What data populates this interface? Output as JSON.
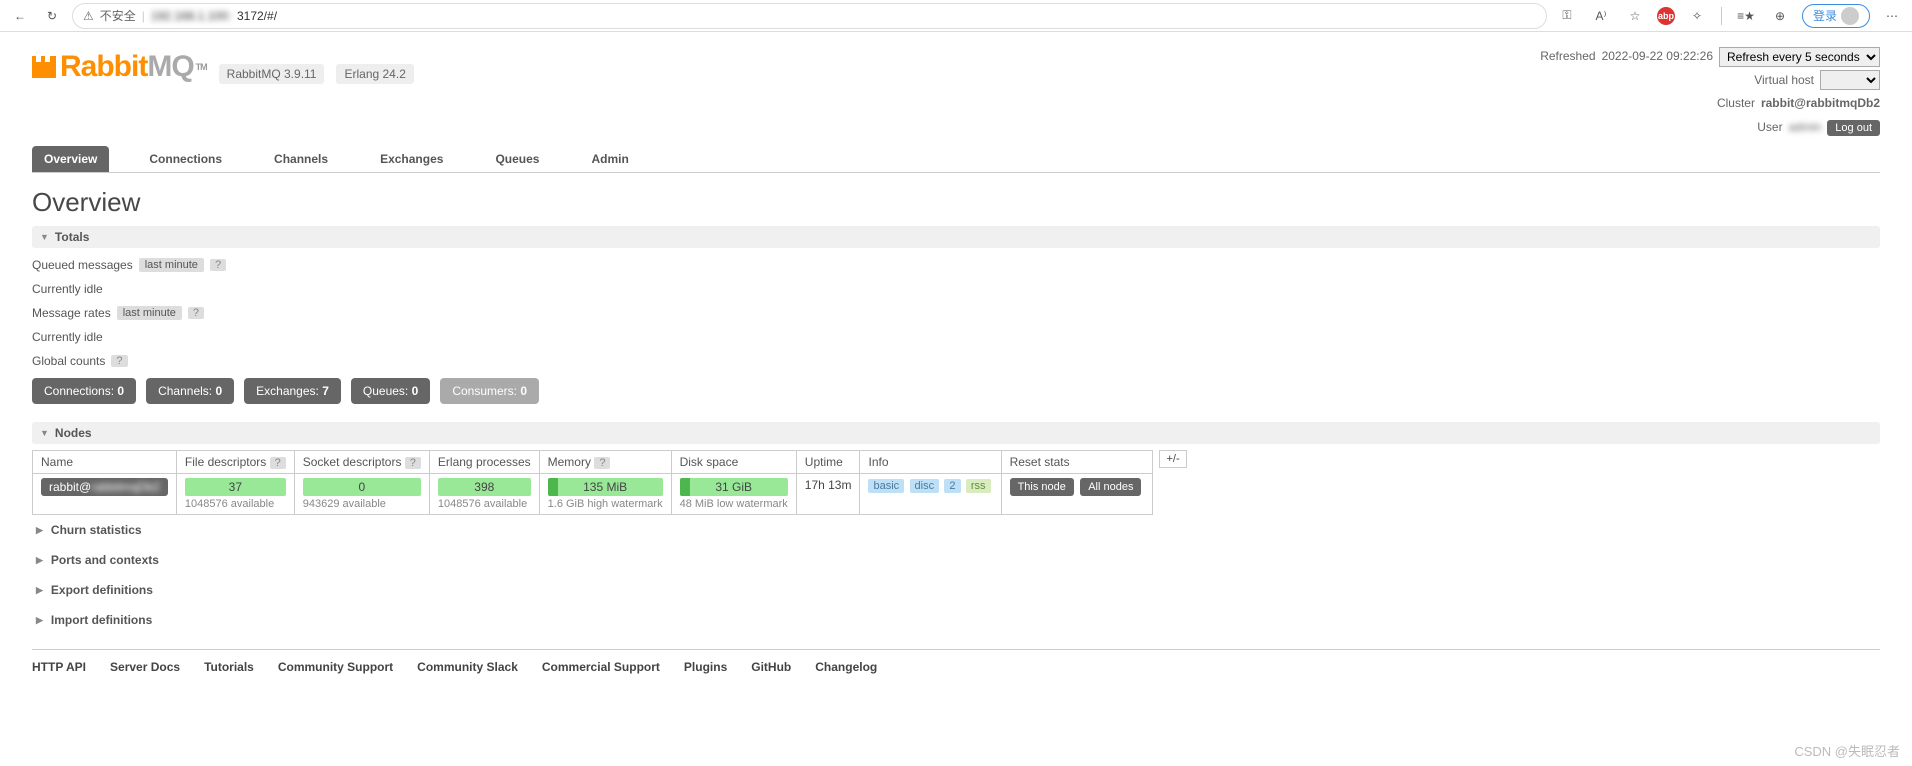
{
  "browser": {
    "insecure": "不安全",
    "url_suffix": "3172/#/",
    "login": "登录"
  },
  "logo": {
    "text1": "Rabbit",
    "text2": "MQ",
    "tm": "TM"
  },
  "versions": {
    "rabbitmq": "RabbitMQ 3.9.11",
    "erlang": "Erlang 24.2"
  },
  "status": {
    "refreshed_label": "Refreshed",
    "refreshed_time": "2022-09-22 09:22:26",
    "refresh_option": "Refresh every 5 seconds",
    "vhost_label": "Virtual host",
    "vhost_value": "",
    "cluster_label": "Cluster",
    "cluster_value": "rabbit@rabbitmqDb2",
    "user_label": "User",
    "user_value": "",
    "logout": "Log out"
  },
  "tabs": [
    "Overview",
    "Connections",
    "Channels",
    "Exchanges",
    "Queues",
    "Admin"
  ],
  "page_title": "Overview",
  "totals": {
    "header": "Totals",
    "queued_label": "Queued messages",
    "last_minute": "last minute",
    "idle1": "Currently idle",
    "rates_label": "Message rates",
    "idle2": "Currently idle",
    "global_counts": "Global counts"
  },
  "counters": [
    {
      "label": "Connections:",
      "val": "0"
    },
    {
      "label": "Channels:",
      "val": "0"
    },
    {
      "label": "Exchanges:",
      "val": "7"
    },
    {
      "label": "Queues:",
      "val": "0"
    },
    {
      "label": "Consumers:",
      "val": "0",
      "dim": true
    }
  ],
  "nodes": {
    "header": "Nodes",
    "plusminus": "+/-",
    "cols": [
      "Name",
      "File descriptors",
      "Socket descriptors",
      "Erlang processes",
      "Memory",
      "Disk space",
      "Uptime",
      "Info",
      "Reset stats"
    ],
    "row": {
      "name_prefix": "rabbit@",
      "name_blur": "rabbitmqDb2",
      "fd": "37",
      "fd_sub": "1048576 available",
      "sd": "0",
      "sd_sub": "943629 available",
      "ep": "398",
      "ep_sub": "1048576 available",
      "mem": "135 MiB",
      "mem_sub": "1.6 GiB high watermark",
      "disk": "31 GiB",
      "disk_sub": "48 MiB low watermark",
      "uptime": "17h 13m",
      "info": [
        "basic",
        "disc",
        "2",
        "rss"
      ],
      "reset1": "This node",
      "reset2": "All nodes"
    }
  },
  "collapsed": [
    "Churn statistics",
    "Ports and contexts",
    "Export definitions",
    "Import definitions"
  ],
  "footer": [
    "HTTP API",
    "Server Docs",
    "Tutorials",
    "Community Support",
    "Community Slack",
    "Commercial Support",
    "Plugins",
    "GitHub",
    "Changelog"
  ],
  "watermark": "CSDN @失眠忍者"
}
